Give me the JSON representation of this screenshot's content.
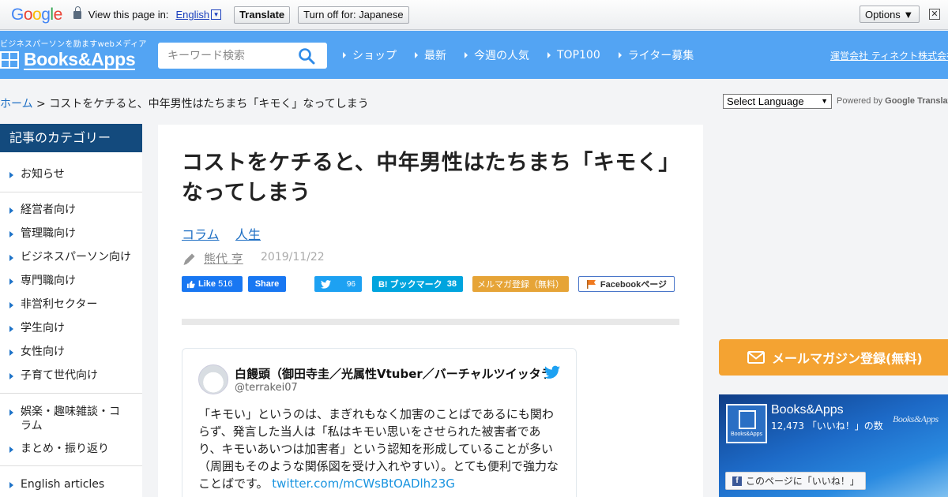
{
  "translate_bar": {
    "google_letters": [
      "G",
      "o",
      "o",
      "g",
      "l",
      "e"
    ],
    "google_colors": [
      "#4285f4",
      "#ea4335",
      "#fbbc05",
      "#4285f4",
      "#34a853",
      "#ea4335"
    ],
    "view_text": "View this page in:",
    "language": "English",
    "translate_label": "Translate",
    "turn_off_label": "Turn off for: Japanese",
    "options_label": "Options ▼",
    "close_glyph": "✕"
  },
  "header": {
    "tagline": "ビジネスパーソンを励ますwebメディア",
    "logo_text": "Books&Apps",
    "search_placeholder": "キーワード検索",
    "nav": [
      "ショップ",
      "最新",
      "今週の人気",
      "TOP100",
      "ライター募集"
    ],
    "company_link": "運営会社 ティネクト株式会社"
  },
  "breadcrumb": {
    "home": "ホーム",
    "separator": " > ",
    "current": "コストをケチると、中年男性はたちまち「キモく」なってしまう"
  },
  "language_widget": {
    "select_label": "Select Language",
    "arrow": "▼",
    "powered_by": "Powered by",
    "google": "Google",
    "translate": "Translate"
  },
  "sidebar": {
    "heading": "記事のカテゴリー",
    "items": [
      "お知らせ",
      "経営者向け",
      "管理職向け",
      "ビジネスパーソン向け",
      "専門職向け",
      "非営利セクター",
      "学生向け",
      "女性向け",
      "子育て世代向け",
      "娯楽・趣味雑談・コラム",
      "まとめ・振り返り",
      "English articles"
    ]
  },
  "article": {
    "title": "コストをケチると、中年男性はたちまち「キモく」なってしまう",
    "tags": [
      "コラム",
      "人生"
    ],
    "author": "熊代 亨",
    "date": "2019/11/22",
    "share": {
      "like_label": "Like",
      "like_count": "516",
      "share_label": "Share",
      "tweet_count": "96",
      "hatena_label": "B! ブックマーク",
      "hatena_count": "38",
      "mailmag_label": "メルマガ登録（無料）",
      "fb_page_label": "Facebookページ"
    }
  },
  "tweet": {
    "name": "白饅頭（御田寺圭／光属性Vtuber／バーチャルツイッタラー）",
    "handle": "@terrakei07",
    "body": "「キモい」というのは、まぎれもなく加害のことばであるにも関わらず、発言した当人は「私はキモい思いをさせられた被害者であり、キモいあいつは加害者」という認知を形成していることが多い（周囲もそのような関係図を受け入れやすい）。とても便利で強力なことばです。",
    "link": "twitter.com/mCWsBtOADlh23G"
  },
  "right": {
    "mail_button": "メールマガジン登録(無料)",
    "fb_name": "Books&Apps",
    "fb_count": "12,473 「いいね！」の数",
    "fb_logo_small": "Books&Apps",
    "fb_watermark": "Books&Apps",
    "fb_like_button": "このページに「いいね！」",
    "fb_f": "f"
  },
  "colors": {
    "header_blue": "#53a4f3",
    "sidebar_head": "#134a7d",
    "link_blue": "#1e6fc4",
    "mail_orange": "#f4a332"
  }
}
